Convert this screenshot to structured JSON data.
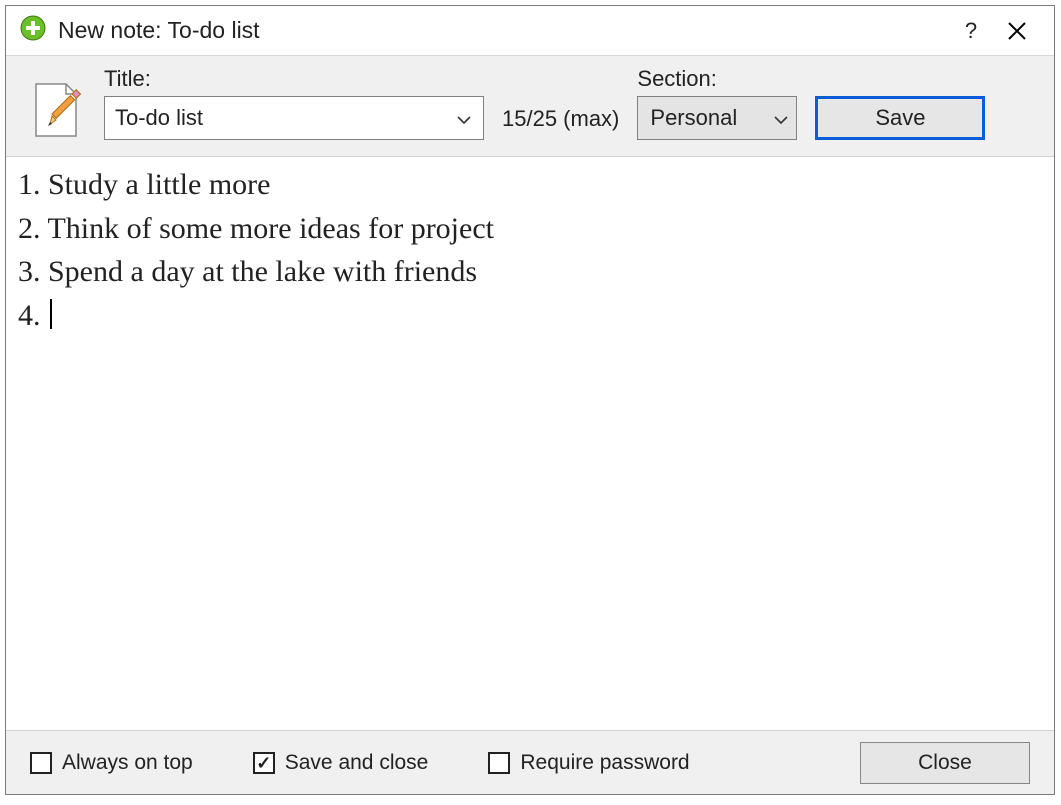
{
  "window": {
    "title": "New note: To-do list"
  },
  "toolbar": {
    "title_label": "Title:",
    "title_value": "To-do list",
    "counter": "15/25 (max)",
    "section_label": "Section:",
    "section_value": "Personal",
    "save_label": "Save"
  },
  "note_lines": [
    "1. Study a little more",
    "2. Think of some more ideas for project",
    "3. Spend a day at the lake with friends",
    "4. "
  ],
  "footer": {
    "always_on_top": {
      "label": "Always on top",
      "checked": false
    },
    "save_and_close": {
      "label": "Save and close",
      "checked": true
    },
    "require_password": {
      "label": "Require password",
      "checked": false
    },
    "close_label": "Close"
  }
}
